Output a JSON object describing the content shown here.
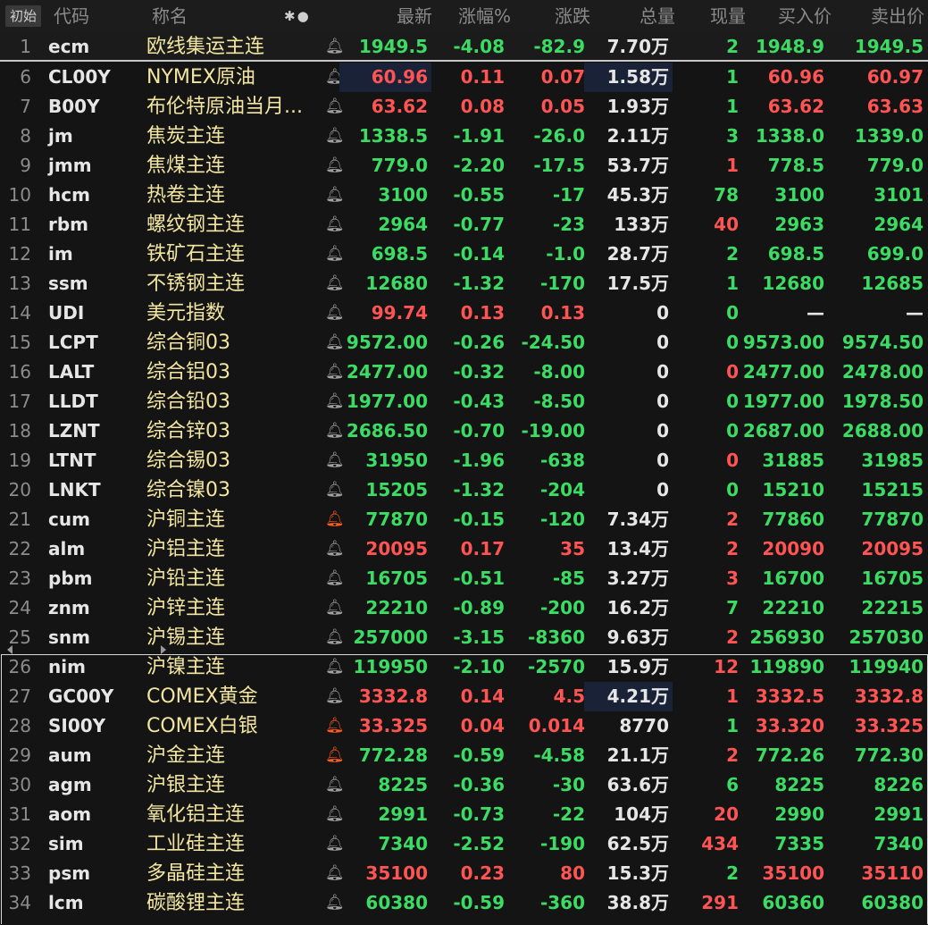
{
  "header": {
    "reset_label": "初始",
    "columns": {
      "code": "代码",
      "name": "称名",
      "last": "最新",
      "pct": "涨幅%",
      "chg": "涨跌",
      "volume": "总量",
      "cur": "现量",
      "bid": "买入价",
      "ask": "卖出价"
    }
  },
  "colors": {
    "up": "#ff5454",
    "down": "#3cdc64",
    "neutral": "#e6e6e6",
    "name": "#f3e6a0",
    "alert": "#ff5a1f"
  },
  "rows": [
    {
      "idx": "1",
      "code": "ecm",
      "name": "欧线集运主连",
      "bell": false,
      "last": "1949.5",
      "pct": "-4.08",
      "chg": "-82.9",
      "volume": "7.70万",
      "cur": "2",
      "bid": "1948.9",
      "ask": "1949.5",
      "dir": "down",
      "cur_dir": "down",
      "bidask_dir": "down",
      "vol_hl": false,
      "last_hl": false
    },
    {
      "idx": "6",
      "code": "CL00Y",
      "name": "NYMEX原油",
      "bell": false,
      "last": "60.96",
      "pct": "0.11",
      "chg": "0.07",
      "volume": "1.58万",
      "cur": "1",
      "bid": "60.96",
      "ask": "60.97",
      "dir": "up",
      "cur_dir": "down",
      "bidask_dir": "up",
      "vol_hl": true,
      "last_hl": true
    },
    {
      "idx": "7",
      "code": "B00Y",
      "name": "布伦特原油当月...",
      "bell": false,
      "last": "63.62",
      "pct": "0.08",
      "chg": "0.05",
      "volume": "1.93万",
      "cur": "1",
      "bid": "63.62",
      "ask": "63.63",
      "dir": "up",
      "cur_dir": "down",
      "bidask_dir": "up",
      "vol_hl": false,
      "last_hl": false
    },
    {
      "idx": "8",
      "code": "jm",
      "name": "焦炭主连",
      "bell": false,
      "last": "1338.5",
      "pct": "-1.91",
      "chg": "-26.0",
      "volume": "2.11万",
      "cur": "3",
      "bid": "1338.0",
      "ask": "1339.0",
      "dir": "down",
      "cur_dir": "down",
      "bidask_dir": "down",
      "vol_hl": false,
      "last_hl": false
    },
    {
      "idx": "9",
      "code": "jmm",
      "name": "焦煤主连",
      "bell": false,
      "last": "779.0",
      "pct": "-2.20",
      "chg": "-17.5",
      "volume": "53.7万",
      "cur": "1",
      "bid": "778.5",
      "ask": "779.0",
      "dir": "down",
      "cur_dir": "up",
      "bidask_dir": "down",
      "vol_hl": false,
      "last_hl": false
    },
    {
      "idx": "10",
      "code": "hcm",
      "name": "热卷主连",
      "bell": false,
      "last": "3100",
      "pct": "-0.55",
      "chg": "-17",
      "volume": "45.3万",
      "cur": "78",
      "bid": "3100",
      "ask": "3101",
      "dir": "down",
      "cur_dir": "down",
      "bidask_dir": "down",
      "vol_hl": false,
      "last_hl": false
    },
    {
      "idx": "11",
      "code": "rbm",
      "name": "螺纹钢主连",
      "bell": false,
      "last": "2964",
      "pct": "-0.77",
      "chg": "-23",
      "volume": "133万",
      "cur": "40",
      "bid": "2963",
      "ask": "2964",
      "dir": "down",
      "cur_dir": "up",
      "bidask_dir": "down",
      "vol_hl": false,
      "last_hl": false
    },
    {
      "idx": "12",
      "code": "im",
      "name": "铁矿石主连",
      "bell": false,
      "last": "698.5",
      "pct": "-0.14",
      "chg": "-1.0",
      "volume": "28.7万",
      "cur": "2",
      "bid": "698.5",
      "ask": "699.0",
      "dir": "down",
      "cur_dir": "down",
      "bidask_dir": "down",
      "vol_hl": false,
      "last_hl": false
    },
    {
      "idx": "13",
      "code": "ssm",
      "name": "不锈钢主连",
      "bell": false,
      "last": "12680",
      "pct": "-1.32",
      "chg": "-170",
      "volume": "17.5万",
      "cur": "1",
      "bid": "12680",
      "ask": "12685",
      "dir": "down",
      "cur_dir": "down",
      "bidask_dir": "down",
      "vol_hl": false,
      "last_hl": false
    },
    {
      "idx": "14",
      "code": "UDI",
      "name": "美元指数",
      "bell": false,
      "last": "99.74",
      "pct": "0.13",
      "chg": "0.13",
      "volume": "0",
      "cur": "0",
      "bid": "—",
      "ask": "—",
      "dir": "up",
      "cur_dir": "down",
      "bidask_dir": "neutral",
      "vol_hl": false,
      "last_hl": false
    },
    {
      "idx": "15",
      "code": "LCPT",
      "name": "综合铜03",
      "bell": false,
      "last": "9572.00",
      "pct": "-0.26",
      "chg": "-24.50",
      "volume": "0",
      "cur": "0",
      "bid": "9573.00",
      "ask": "9574.50",
      "dir": "down",
      "cur_dir": "down",
      "bidask_dir": "down",
      "vol_hl": false,
      "last_hl": false
    },
    {
      "idx": "16",
      "code": "LALT",
      "name": "综合铝03",
      "bell": false,
      "last": "2477.00",
      "pct": "-0.32",
      "chg": "-8.00",
      "volume": "0",
      "cur": "0",
      "bid": "2477.00",
      "ask": "2478.00",
      "dir": "down",
      "cur_dir": "up",
      "bidask_dir": "down",
      "vol_hl": false,
      "last_hl": false
    },
    {
      "idx": "17",
      "code": "LLDT",
      "name": "综合铅03",
      "bell": false,
      "last": "1977.00",
      "pct": "-0.43",
      "chg": "-8.50",
      "volume": "0",
      "cur": "0",
      "bid": "1977.00",
      "ask": "1978.50",
      "dir": "down",
      "cur_dir": "down",
      "bidask_dir": "down",
      "vol_hl": false,
      "last_hl": false
    },
    {
      "idx": "18",
      "code": "LZNT",
      "name": "综合锌03",
      "bell": false,
      "last": "2686.50",
      "pct": "-0.70",
      "chg": "-19.00",
      "volume": "0",
      "cur": "0",
      "bid": "2687.00",
      "ask": "2688.00",
      "dir": "down",
      "cur_dir": "down",
      "bidask_dir": "down",
      "vol_hl": false,
      "last_hl": false
    },
    {
      "idx": "19",
      "code": "LTNT",
      "name": "综合锡03",
      "bell": false,
      "last": "31950",
      "pct": "-1.96",
      "chg": "-638",
      "volume": "0",
      "cur": "0",
      "bid": "31885",
      "ask": "31985",
      "dir": "down",
      "cur_dir": "up",
      "bidask_dir": "down",
      "vol_hl": false,
      "last_hl": false
    },
    {
      "idx": "20",
      "code": "LNKT",
      "name": "综合镍03",
      "bell": false,
      "last": "15205",
      "pct": "-1.32",
      "chg": "-204",
      "volume": "0",
      "cur": "0",
      "bid": "15210",
      "ask": "15215",
      "dir": "down",
      "cur_dir": "down",
      "bidask_dir": "down",
      "vol_hl": false,
      "last_hl": false
    },
    {
      "idx": "21",
      "code": "cum",
      "name": "沪铜主连",
      "bell": true,
      "last": "77870",
      "pct": "-0.15",
      "chg": "-120",
      "volume": "7.34万",
      "cur": "2",
      "bid": "77860",
      "ask": "77870",
      "dir": "down",
      "cur_dir": "up",
      "bidask_dir": "down",
      "vol_hl": false,
      "last_hl": false
    },
    {
      "idx": "22",
      "code": "alm",
      "name": "沪铝主连",
      "bell": false,
      "last": "20095",
      "pct": "0.17",
      "chg": "35",
      "volume": "13.4万",
      "cur": "2",
      "bid": "20090",
      "ask": "20095",
      "dir": "up",
      "cur_dir": "up",
      "bidask_dir": "up",
      "vol_hl": false,
      "last_hl": false
    },
    {
      "idx": "23",
      "code": "pbm",
      "name": "沪铅主连",
      "bell": false,
      "last": "16705",
      "pct": "-0.51",
      "chg": "-85",
      "volume": "3.27万",
      "cur": "3",
      "bid": "16700",
      "ask": "16705",
      "dir": "down",
      "cur_dir": "up",
      "bidask_dir": "down",
      "vol_hl": false,
      "last_hl": false
    },
    {
      "idx": "24",
      "code": "znm",
      "name": "沪锌主连",
      "bell": false,
      "last": "22210",
      "pct": "-0.89",
      "chg": "-200",
      "volume": "16.2万",
      "cur": "7",
      "bid": "22210",
      "ask": "22215",
      "dir": "down",
      "cur_dir": "down",
      "bidask_dir": "down",
      "vol_hl": false,
      "last_hl": false
    },
    {
      "idx": "25",
      "code": "snm",
      "name": "沪锡主连",
      "bell": false,
      "last": "257000",
      "pct": "-3.15",
      "chg": "-8360",
      "volume": "9.63万",
      "cur": "2",
      "bid": "256930",
      "ask": "257030",
      "dir": "down",
      "cur_dir": "up",
      "bidask_dir": "down",
      "vol_hl": false,
      "last_hl": false
    },
    {
      "idx": "26",
      "code": "nim",
      "name": "沪镍主连",
      "bell": false,
      "last": "119950",
      "pct": "-2.10",
      "chg": "-2570",
      "volume": "15.9万",
      "cur": "12",
      "bid": "119890",
      "ask": "119940",
      "dir": "down",
      "cur_dir": "up",
      "bidask_dir": "down",
      "vol_hl": false,
      "last_hl": false
    },
    {
      "idx": "27",
      "code": "GC00Y",
      "name": "COMEX黄金",
      "bell": false,
      "last": "3332.8",
      "pct": "0.14",
      "chg": "4.5",
      "volume": "4.21万",
      "cur": "1",
      "bid": "3332.5",
      "ask": "3332.8",
      "dir": "up",
      "cur_dir": "up",
      "bidask_dir": "up",
      "vol_hl": true,
      "last_hl": false
    },
    {
      "idx": "28",
      "code": "SI00Y",
      "name": "COMEX白银",
      "bell": true,
      "last": "33.325",
      "pct": "0.04",
      "chg": "0.014",
      "volume": "8770",
      "cur": "1",
      "bid": "33.320",
      "ask": "33.325",
      "dir": "up",
      "cur_dir": "down",
      "bidask_dir": "up",
      "vol_hl": false,
      "last_hl": false
    },
    {
      "idx": "29",
      "code": "aum",
      "name": "沪金主连",
      "bell": true,
      "last": "772.28",
      "pct": "-0.59",
      "chg": "-4.58",
      "volume": "21.1万",
      "cur": "2",
      "bid": "772.26",
      "ask": "772.30",
      "dir": "down",
      "cur_dir": "up",
      "bidask_dir": "down",
      "vol_hl": false,
      "last_hl": false
    },
    {
      "idx": "30",
      "code": "agm",
      "name": "沪银主连",
      "bell": false,
      "last": "8225",
      "pct": "-0.36",
      "chg": "-30",
      "volume": "63.6万",
      "cur": "6",
      "bid": "8225",
      "ask": "8226",
      "dir": "down",
      "cur_dir": "down",
      "bidask_dir": "down",
      "vol_hl": false,
      "last_hl": false
    },
    {
      "idx": "31",
      "code": "aom",
      "name": "氧化铝主连",
      "bell": false,
      "last": "2991",
      "pct": "-0.73",
      "chg": "-22",
      "volume": "104万",
      "cur": "20",
      "bid": "2990",
      "ask": "2991",
      "dir": "down",
      "cur_dir": "up",
      "bidask_dir": "down",
      "vol_hl": false,
      "last_hl": false
    },
    {
      "idx": "32",
      "code": "sim",
      "name": "工业硅主连",
      "bell": false,
      "last": "7340",
      "pct": "-2.52",
      "chg": "-190",
      "volume": "62.5万",
      "cur": "434",
      "bid": "7335",
      "ask": "7340",
      "dir": "down",
      "cur_dir": "up",
      "bidask_dir": "down",
      "vol_hl": false,
      "last_hl": false
    },
    {
      "idx": "33",
      "code": "psm",
      "name": "多晶硅主连",
      "bell": false,
      "last": "35100",
      "pct": "0.23",
      "chg": "80",
      "volume": "15.3万",
      "cur": "2",
      "bid": "35100",
      "ask": "35110",
      "dir": "up",
      "cur_dir": "down",
      "bidask_dir": "up",
      "vol_hl": false,
      "last_hl": false
    },
    {
      "idx": "34",
      "code": "lcm",
      "name": "碳酸锂主连",
      "bell": false,
      "last": "60380",
      "pct": "-0.59",
      "chg": "-360",
      "volume": "38.8万",
      "cur": "291",
      "bid": "60360",
      "ask": "60380",
      "dir": "down",
      "cur_dir": "up",
      "bidask_dir": "down",
      "vol_hl": false,
      "last_hl": false
    }
  ]
}
